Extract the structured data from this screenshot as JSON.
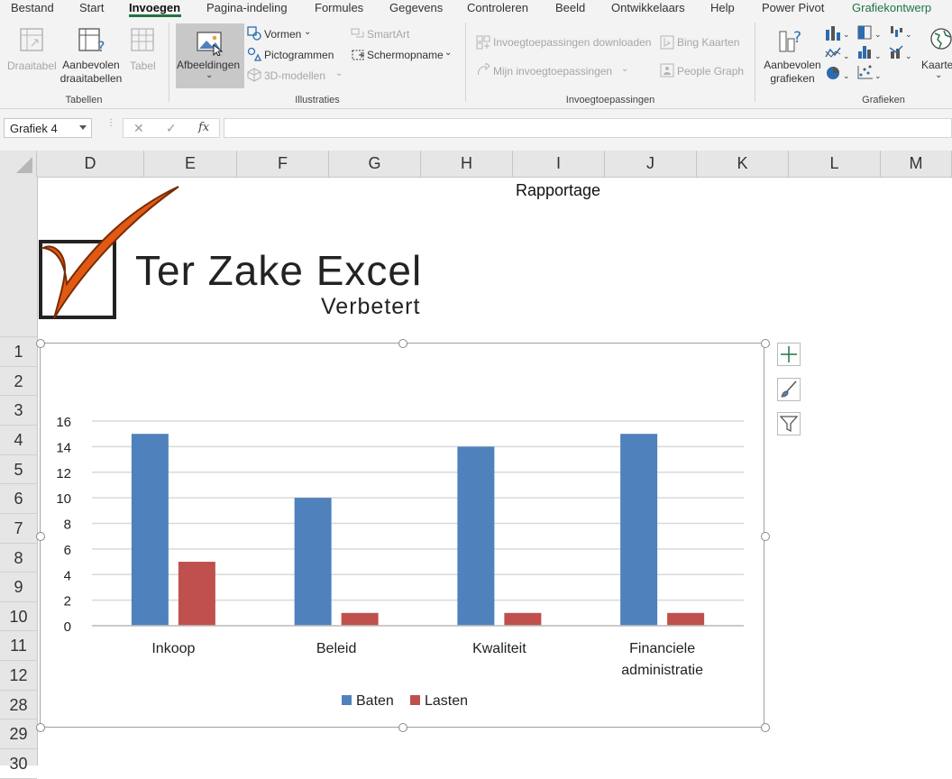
{
  "menu": {
    "tabs": [
      "Bestand",
      "Start",
      "Invoegen",
      "Pagina-indeling",
      "Formules",
      "Gegevens",
      "Controleren",
      "Beeld",
      "Ontwikkelaars",
      "Help",
      "Power Pivot",
      "Grafiekontwerp"
    ],
    "active": "Invoegen"
  },
  "ribbon": {
    "tables": {
      "draaitabel": "Draaitabel",
      "aanbevolen_line1": "Aanbevolen",
      "aanbevolen_line2": "draaitabellen",
      "tabel": "Tabel",
      "group": "Tabellen"
    },
    "illustrations": {
      "afbeeldingen": "Afbeeldingen",
      "vormen": "Vormen",
      "pictogrammen": "Pictogrammen",
      "modellen3d": "3D-modellen",
      "smartart": "SmartArt",
      "schermopname": "Schermopname",
      "group": "Illustraties"
    },
    "addins": {
      "download": "Invoegtoepassingen downloaden",
      "mine": "Mijn invoegtoepassingen",
      "bing": "Bing Kaarten",
      "people": "People Graph",
      "group": "Invoegtoepassingen"
    },
    "charts": {
      "aanbevolen_line1": "Aanbevolen",
      "aanbevolen_line2": "grafieken",
      "kaarten": "Kaarten",
      "group": "Grafieken"
    }
  },
  "formula_bar": {
    "name_box": "Grafiek 4",
    "cancel": "✕",
    "enter": "✓",
    "fx": "fx",
    "value": ""
  },
  "columns": [
    "D",
    "E",
    "F",
    "G",
    "H",
    "I",
    "J",
    "K",
    "L",
    "M"
  ],
  "rows": [
    "1",
    "2",
    "3",
    "4",
    "5",
    "6",
    "7",
    "8",
    "9",
    "10",
    "11",
    "12",
    "28",
    "29",
    "30"
  ],
  "sheet": {
    "report_title": "Rapportage",
    "logo_main": "Ter Zake Excel",
    "logo_sub": "Verbetert"
  },
  "colors": {
    "accent": "#217346",
    "baten": "#4f81bd",
    "lasten": "#c0504d",
    "logo_orange": "#e05a14"
  },
  "chart_data": {
    "type": "bar",
    "categories": [
      "Inkoop",
      "Beleid",
      "Kwaliteit",
      "Financiele administratie"
    ],
    "series": [
      {
        "name": "Baten",
        "values": [
          15,
          10,
          14,
          15
        ]
      },
      {
        "name": "Lasten",
        "values": [
          5,
          1,
          1,
          1
        ]
      }
    ],
    "ylim": [
      0,
      16
    ],
    "yticks": [
      0,
      2,
      4,
      6,
      8,
      10,
      12,
      14,
      16
    ],
    "grid": true,
    "legend": "bottom"
  }
}
